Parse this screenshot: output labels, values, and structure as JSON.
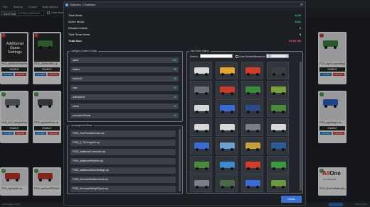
{
  "app": {
    "menu": [
      "File",
      "Backup",
      "Export",
      "Bulk Actions"
    ],
    "toolbar": {
      "button": "Add Folder",
      "path": "D:\\FS25_MODS\\ZIP",
      "case_label": "Case Sensitive"
    }
  },
  "cards": [
    {
      "name": "FS25_AdditionalGameSett...",
      "enable": "ENABLE",
      "folder": "FOLDER",
      "delete": "DELETE",
      "badge": "!"
    },
    {
      "name": "FS25_AddNewBMX.zip",
      "enable": "ENABLE",
      "folder": "FOLDER",
      "delete": "DELETE",
      "badge": "!"
    },
    {
      "name": "FS25_AgriCompactWeight...",
      "enable": "ENABLE",
      "folder": "FOLDER",
      "delete": "DELETE",
      "badge": "!"
    },
    {
      "name": "FS25_AG2_WeightsPack...",
      "enable": "ENABLE",
      "folder": "FOLDER",
      "delete": "DELETE",
      "badge": "✓"
    },
    {
      "name": "FS25_agAddedPack.zip",
      "enable": "ENABLE",
      "folder": "FOLDER",
      "delete": "DELETE",
      "badge": "✓"
    },
    {
      "name": "FS25_agAtWeight.zip",
      "enable": "ENABLE",
      "folder": "FOLDER",
      "delete": "DELETE",
      "badge": "✓"
    },
    {
      "name": "FS25_AgriOptiMI.zip",
      "enable": "ENABLE",
      "folder": "FOLDER",
      "delete": "DELETE",
      "badge": "✓"
    },
    {
      "name": "FS25_AgriModPlEEDWe...",
      "enable": "ENABLE",
      "folder": "FOLDER",
      "delete": "DELETE",
      "badge": "✓"
    },
    {
      "name": "FS25_AllInOneBatterySy...",
      "enable": "ENABLE",
      "folder": "FOLDER",
      "delete": "DELETE",
      "badge": "✓"
    }
  ],
  "card_logo": {
    "line1": "All",
    "line2": "One",
    "sub": "Live Realworld"
  },
  "statusbar": {
    "left": "Last Loaded: 1449",
    "right": "Mod Version"
  },
  "dialog": {
    "title": "Statistics / Gratistiter",
    "close_glyph": "✕",
    "stats": [
      {
        "label": "Total Mods:",
        "value": "1449",
        "color": "#33d36b"
      },
      {
        "label": "Active Mods:",
        "value": "1341",
        "color": "#33d36b"
      },
      {
        "label": "Disabled Mods:",
        "value": "8",
        "color": "#ff9a2e"
      },
      {
        "label": "Total Store Items:",
        "value": "0",
        "color": "#e5e8ec"
      },
      {
        "label": "Total Size:",
        "value": "33.98 GB",
        "color": "#ff5a5a"
      }
    ],
    "category_panel": {
      "title": "Category Content Counts",
      "rows": [
        {
          "label": "pleas",
          "count": "145"
        },
        {
          "label": "trailers",
          "count": "58"
        },
        {
          "label": "tractorsS",
          "count": "58"
        },
        {
          "label": "cars",
          "count": "52"
        },
        {
          "label": "animalpens",
          "count": "47"
        },
        {
          "label": "sheds",
          "count": "41"
        },
        {
          "label": "productionPoints",
          "count": "41"
        }
      ]
    },
    "uncategorized_panel": {
      "title": "Uncategorized Mods",
      "rows": [
        "FS25_VersFarmMachines.zip",
        "FS25_S_ThDesignKit.zip",
        "FS25_additionalCurrencies.zip",
        "FS25_additionalFieldInfo.zip",
        "FS25_additionalGameSettings.zip",
        "FS25_AdvancedMaintenance.zip",
        "FS25_AdvancedWeightTypes.zip"
      ]
    },
    "gallery": {
      "title": "Mod Store Gallery",
      "search_label": "Search:",
      "case_label": "Case Sensitive",
      "search_in_label": "Search in:",
      "select_value": "All",
      "vehicle_colors": [
        "#d8d8d8",
        "#e4a62a",
        "#d83a2a",
        "#3a3f47",
        "#6a6f77",
        "#c83a2a",
        "#3c8a3c",
        "#7aa03a",
        "#d8d8d8",
        "#3a6ad8",
        "#2a4a8a",
        "#4a8a3a",
        "#d8d8d8",
        "#d8d8d8",
        "#7a7f87",
        "#d8d8d8",
        "#3a6ad8",
        "#6aa0d0",
        "#c8a03a",
        "#2a5a9a",
        "#4a8a3a",
        "#3a8ad0",
        "#d83a2a",
        "#3a9a3a",
        "#7a7f87",
        "#4a6a4a",
        "#3a6ad8",
        "#6a9a3a"
      ]
    },
    "close_button": "Close"
  }
}
